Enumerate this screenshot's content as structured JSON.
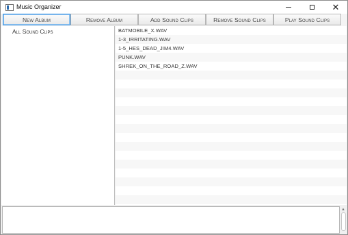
{
  "window": {
    "title": "Music Organizer",
    "controls": {
      "minimize": "—",
      "maximize": "☐",
      "close": "✕"
    }
  },
  "toolbar": {
    "new_album": "New Album",
    "remove_album": "Remove Album",
    "add_sound_clips": "Add Sound Clips",
    "remove_sound_clips": "Remove Sound Clips",
    "play_sound_clips": "Play Sound Clips"
  },
  "albums": {
    "items": [
      {
        "label": "All Sound Clips"
      }
    ]
  },
  "clips": {
    "items": [
      {
        "name": "BATMOBILE_X.WAV"
      },
      {
        "name": "1-3_IRRITATING.WAV"
      },
      {
        "name": "1-5_HES_DEAD_JIM4.WAV"
      },
      {
        "name": "PUNK.WAV"
      },
      {
        "name": "SHREK_ON_THE_ROAD_Z.WAV"
      }
    ]
  },
  "log": {
    "text": ""
  },
  "colors": {
    "focus_border": "#2a8adf",
    "alt_row": "#f7f7f7"
  }
}
